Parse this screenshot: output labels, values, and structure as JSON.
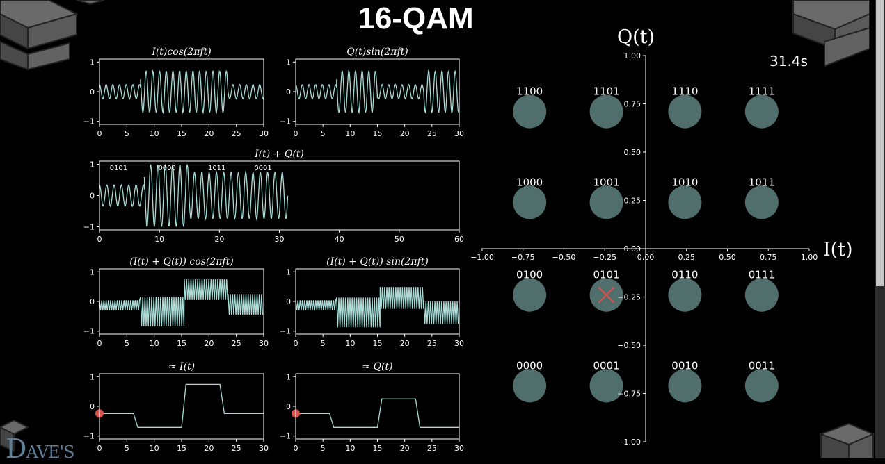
{
  "page": {
    "title": "16-QAM",
    "timer": "31.4s",
    "info_icon": "info-icon",
    "logo_text": "DAVE'S"
  },
  "colors": {
    "background": "#000000",
    "wave": "#a8dcd6",
    "marker": "#d9534f",
    "dot": "#4f6e6c"
  },
  "chart_data": [
    {
      "type": "line",
      "panel": "p1",
      "title": "I(t)cos(2πft)",
      "xlim": [
        0,
        30
      ],
      "ylim": [
        -1.1,
        1.1
      ],
      "xticks": [
        "0",
        "5",
        "10",
        "15",
        "20",
        "25",
        "30"
      ],
      "yticks": [
        "-1",
        "0",
        "1"
      ],
      "series": [
        {
          "amplitude_segments": [
            {
              "x": [
                0,
                7.5
              ],
              "amp": 0.24
            },
            {
              "x": [
                7.5,
                15
              ],
              "amp": 0.71
            },
            {
              "x": [
                15,
                23.5
              ],
              "amp": 0.71
            },
            {
              "x": [
                23.5,
                30
              ],
              "amp": 0.24
            }
          ],
          "cycles_per_unit": 0.82
        }
      ]
    },
    {
      "type": "line",
      "panel": "p2",
      "title": "Q(t)sin(2πft)",
      "xlim": [
        0,
        30
      ],
      "ylim": [
        -1.1,
        1.1
      ],
      "xticks": [
        "0",
        "5",
        "10",
        "15",
        "20",
        "25",
        "30"
      ],
      "yticks": [
        "-1",
        "0",
        "1"
      ],
      "series": [
        {
          "amplitude_segments": [
            {
              "x": [
                0,
                7.5
              ],
              "amp": 0.24
            },
            {
              "x": [
                7.5,
                15
              ],
              "amp": 0.71
            },
            {
              "x": [
                15,
                23.5
              ],
              "amp": 0.24
            },
            {
              "x": [
                23.5,
                30
              ],
              "amp": 0.71
            }
          ],
          "cycles_per_unit": 0.82
        }
      ]
    },
    {
      "type": "line",
      "panel": "p3",
      "title": "I(t) + Q(t)",
      "xlim": [
        0,
        60
      ],
      "ylim": [
        -1.1,
        1.1
      ],
      "xticks": [
        "0",
        "10",
        "20",
        "30",
        "40",
        "50",
        "60"
      ],
      "yticks": [
        "-1",
        "0",
        "1"
      ],
      "segment_labels": [
        {
          "x": 1.7,
          "text": "0101"
        },
        {
          "x": 9.8,
          "text": "0000"
        },
        {
          "x": 18.1,
          "text": "1011"
        },
        {
          "x": 25.8,
          "text": "0001"
        }
      ],
      "series": [
        {
          "amplitude_segments": [
            {
              "x": [
                0,
                7.5
              ],
              "amp": 0.34
            },
            {
              "x": [
                7.5,
                15
              ],
              "amp": 1.0
            },
            {
              "x": [
                15,
                23.5
              ],
              "amp": 0.75
            },
            {
              "x": [
                23.5,
                31.4
              ],
              "amp": 0.75
            }
          ],
          "cycles_per_unit": 0.82
        }
      ]
    },
    {
      "type": "line",
      "panel": "p4",
      "title": "(I(t) + Q(t)) cos(2πft)",
      "xlim": [
        0,
        30
      ],
      "ylim": [
        -1.1,
        1.1
      ],
      "xticks": [
        "0",
        "5",
        "10",
        "15",
        "20",
        "25",
        "30"
      ],
      "yticks": [
        "-1",
        "0",
        "1"
      ],
      "series": [
        {
          "band_segments": [
            {
              "x": [
                0,
                7.5
              ],
              "center": -0.13,
              "half": 0.17
            },
            {
              "x": [
                7.5,
                15.5
              ],
              "center": -0.34,
              "half": 0.5
            },
            {
              "x": [
                15.5,
                23.5
              ],
              "center": 0.4,
              "half": 0.35
            },
            {
              "x": [
                23.5,
                30
              ],
              "center": -0.1,
              "half": 0.35
            }
          ]
        }
      ]
    },
    {
      "type": "line",
      "panel": "p5",
      "title": "(I(t) + Q(t)) sin(2πft)",
      "xlim": [
        0,
        30
      ],
      "ylim": [
        -1.1,
        1.1
      ],
      "xticks": [
        "0",
        "5",
        "10",
        "15",
        "20",
        "25",
        "30"
      ],
      "yticks": [
        "-1",
        "0",
        "1"
      ],
      "series": [
        {
          "band_segments": [
            {
              "x": [
                0,
                7.5
              ],
              "center": -0.13,
              "half": 0.17
            },
            {
              "x": [
                7.5,
                15.5
              ],
              "center": -0.37,
              "half": 0.5
            },
            {
              "x": [
                15.5,
                23.5
              ],
              "center": 0.12,
              "half": 0.37
            },
            {
              "x": [
                23.5,
                30
              ],
              "center": -0.38,
              "half": 0.38
            }
          ]
        }
      ]
    },
    {
      "type": "line",
      "panel": "p6",
      "title": "≈ I(t)",
      "xlim": [
        0,
        30
      ],
      "ylim": [
        -1.1,
        1.1
      ],
      "xticks": [
        "0",
        "5",
        "10",
        "15",
        "20",
        "25",
        "30"
      ],
      "yticks": [
        "-1",
        "0",
        "1"
      ],
      "series": [
        {
          "x": [
            0,
            6.2,
            7.0,
            15.0,
            15.8,
            22.0,
            22.8,
            30
          ],
          "y": [
            -0.24,
            -0.24,
            -0.71,
            -0.71,
            0.74,
            0.74,
            -0.24,
            -0.24
          ]
        }
      ],
      "marker": {
        "x": 0,
        "y": -0.24
      }
    },
    {
      "type": "line",
      "panel": "p7",
      "title": "≈ Q(t)",
      "xlim": [
        0,
        30
      ],
      "ylim": [
        -1.1,
        1.1
      ],
      "xticks": [
        "0",
        "5",
        "10",
        "15",
        "20",
        "25",
        "30"
      ],
      "yticks": [
        "-1",
        "0",
        "1"
      ],
      "series": [
        {
          "x": [
            0,
            6.2,
            7.0,
            15.0,
            15.8,
            22.0,
            22.8,
            30
          ],
          "y": [
            -0.24,
            -0.24,
            -0.71,
            -0.71,
            0.25,
            0.25,
            -0.71,
            -0.71
          ]
        }
      ],
      "marker": {
        "x": 0,
        "y": -0.24
      }
    },
    {
      "type": "scatter",
      "panel": "constellation",
      "xlabel": "I(t)",
      "ylabel": "Q(t)",
      "xlim": [
        -1,
        1
      ],
      "ylim": [
        -1,
        1
      ],
      "xticks": [
        "-1.00",
        "-0.75",
        "-0.50",
        "-0.25",
        "0.00",
        "0.25",
        "0.50",
        "0.75",
        "1.00"
      ],
      "yticks": [
        "1.00",
        "0.75",
        "0.50",
        "0.25",
        "0.00",
        "-0.25",
        "-0.50",
        "-0.75",
        "-1.00"
      ],
      "points": [
        {
          "x": -0.71,
          "y": 0.71,
          "label": "1100"
        },
        {
          "x": -0.24,
          "y": 0.71,
          "label": "1101"
        },
        {
          "x": 0.24,
          "y": 0.71,
          "label": "1110"
        },
        {
          "x": 0.71,
          "y": 0.71,
          "label": "1111"
        },
        {
          "x": -0.71,
          "y": 0.24,
          "label": "1000"
        },
        {
          "x": -0.24,
          "y": 0.24,
          "label": "1001"
        },
        {
          "x": 0.24,
          "y": 0.24,
          "label": "1010"
        },
        {
          "x": 0.71,
          "y": 0.24,
          "label": "1011"
        },
        {
          "x": -0.71,
          "y": -0.24,
          "label": "0100"
        },
        {
          "x": -0.24,
          "y": -0.24,
          "label": "0101"
        },
        {
          "x": 0.24,
          "y": -0.24,
          "label": "0110"
        },
        {
          "x": 0.71,
          "y": -0.24,
          "label": "0111"
        },
        {
          "x": -0.71,
          "y": -0.71,
          "label": "0000"
        },
        {
          "x": -0.24,
          "y": -0.71,
          "label": "0001"
        },
        {
          "x": 0.24,
          "y": -0.71,
          "label": "0010"
        },
        {
          "x": 0.71,
          "y": -0.71,
          "label": "0011"
        }
      ],
      "current_marker": {
        "x": -0.24,
        "y": -0.24
      }
    }
  ]
}
